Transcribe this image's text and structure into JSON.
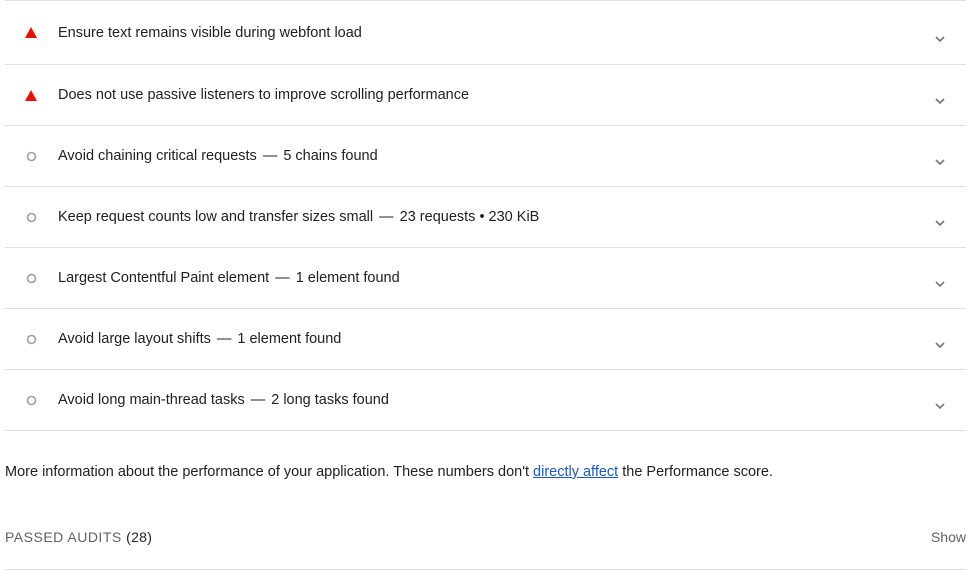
{
  "audits": [
    {
      "status": "fail",
      "title": "Ensure text remains visible during webfont load",
      "detail": ""
    },
    {
      "status": "fail",
      "title": "Does not use passive listeners to improve scrolling performance",
      "detail": ""
    },
    {
      "status": "info",
      "title": "Avoid chaining critical requests",
      "detail": "5 chains found"
    },
    {
      "status": "info",
      "title": "Keep request counts low and transfer sizes small",
      "detail": "23 requests • 230 KiB"
    },
    {
      "status": "info",
      "title": "Largest Contentful Paint element",
      "detail": "1 element found"
    },
    {
      "status": "info",
      "title": "Avoid large layout shifts",
      "detail": "1 element found"
    },
    {
      "status": "info",
      "title": "Avoid long main-thread tasks",
      "detail": "2 long tasks found"
    }
  ],
  "separator": "—",
  "more_info": {
    "before": "More information about the performance of your application. These numbers don't ",
    "link": "directly affect",
    "after": " the Performance score."
  },
  "passed": {
    "label": "PASSED AUDITS",
    "count": "(28)",
    "show": "Show"
  },
  "colors": {
    "fail": "#eb0f00",
    "info_circle": "#9e9e9e",
    "chevron": "#757575",
    "link": "#1558d6"
  },
  "icons": {
    "fail": "warning-triangle-icon",
    "info": "circle-outline-icon",
    "expand": "chevron-down-icon"
  }
}
